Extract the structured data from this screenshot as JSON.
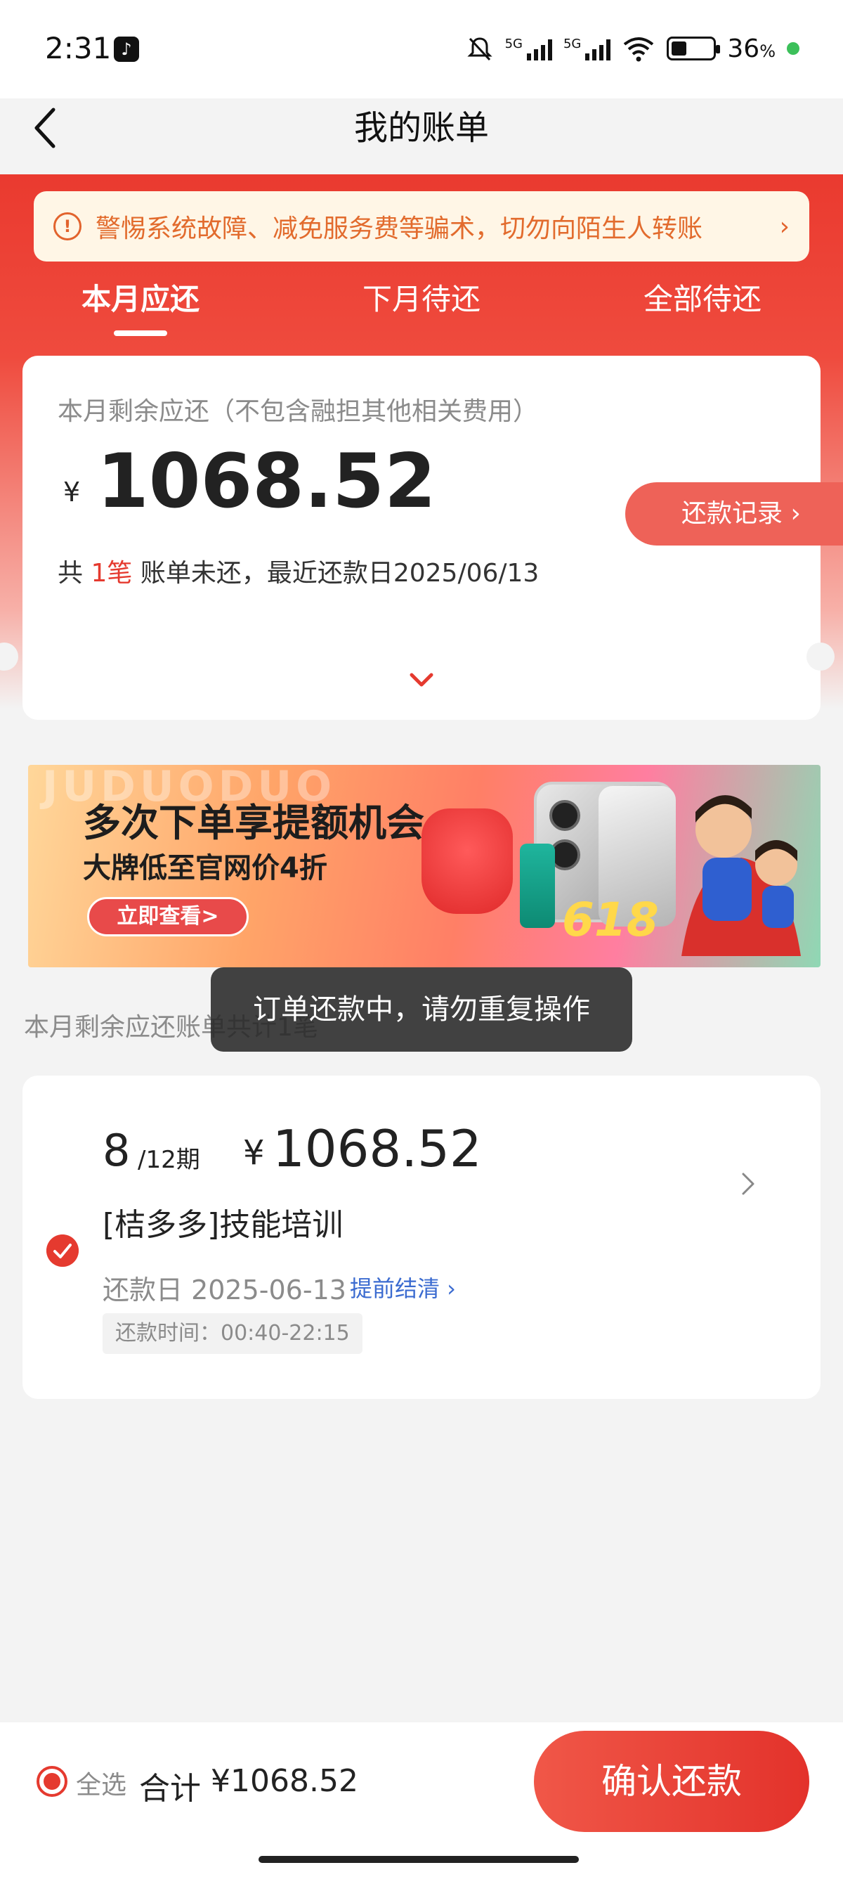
{
  "status_bar": {
    "time": "2:31",
    "signal_label_1": "5G",
    "signal_label_2": "5G",
    "battery_percent": "36",
    "battery_suffix": "%",
    "battery_level": 0.36,
    "icons": [
      "tiktok-icon",
      "mute-icon",
      "signal-icon",
      "wifi-icon",
      "battery-icon"
    ]
  },
  "header": {
    "title": "我的账单",
    "back_icon": "chevron-left-icon"
  },
  "warning": {
    "text": "警惕系统故障、减免服务费等骗术，切勿向陌生人转账",
    "icon": "!",
    "arrow": "›"
  },
  "tabs": [
    {
      "label": "本月应还",
      "active": true
    },
    {
      "label": "下月待还",
      "active": false
    },
    {
      "label": "全部待还",
      "active": false
    }
  ],
  "summary_card": {
    "subtitle": "本月剩余应还（不包含融担其他相关费用）",
    "currency": "¥",
    "amount": "1068.52",
    "prefix": "共",
    "count": "1笔",
    "suffix": "账单未还，最近还款日2025/06/13",
    "repay_record_label": "还款记录 ›"
  },
  "promo": {
    "watermark": "JUDUODUO",
    "title": "多次下单享提额机会",
    "subtitle": "大牌低至官网价4折",
    "button": "立即查看>",
    "badge": "618"
  },
  "section": {
    "label": "本月剩余应还账单共计1笔"
  },
  "toast": {
    "text": "订单还款中，请勿重复操作"
  },
  "bill_item": {
    "period_current": "8",
    "period_total": "/12期",
    "currency": "¥",
    "amount": "1068.52",
    "name": "[桔多多]技能培训",
    "due_date": "还款日 2025-06-13",
    "early_settle": "提前结清 ›",
    "repay_time": "还款时间：00:40-22:15",
    "selected": true
  },
  "footer": {
    "select_all_label": "全选",
    "total_label": "合计",
    "total_amount": "¥1068.52",
    "confirm_label": "确认还款"
  },
  "colors": {
    "primary_red": "#e53a2f",
    "warning_orange": "#e26b2d",
    "link_blue": "#3b6bd0"
  }
}
